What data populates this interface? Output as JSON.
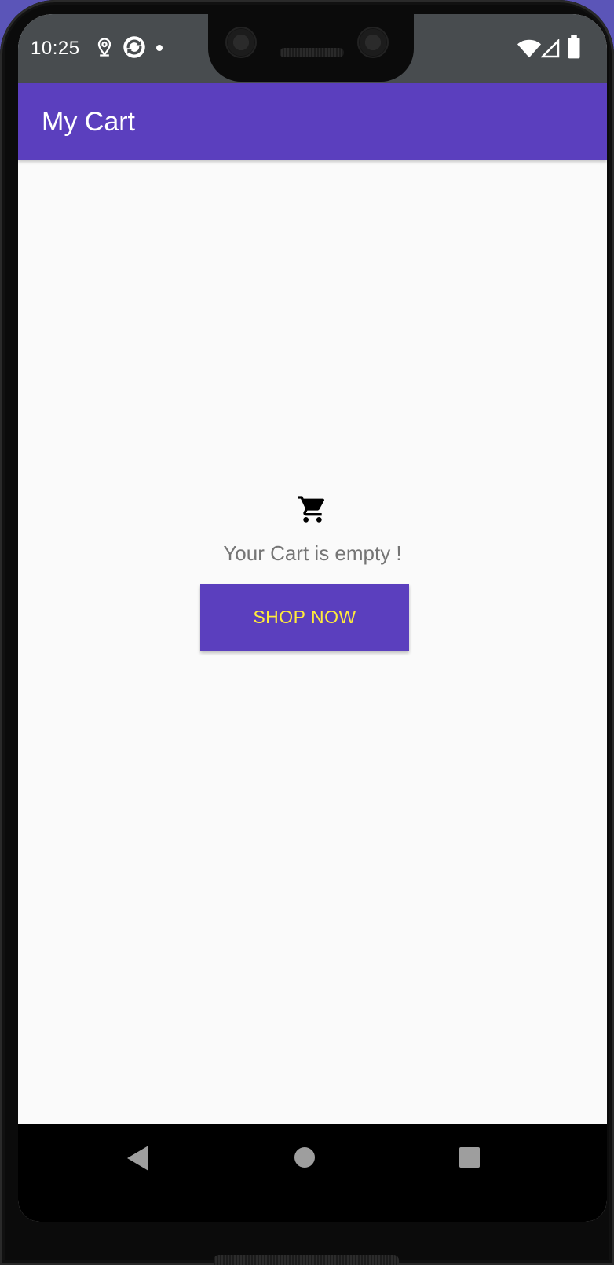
{
  "status_bar": {
    "time": "10:25",
    "left_icons": [
      "location-icon",
      "sync-icon",
      "dot-icon"
    ],
    "right_icons": [
      "wifi-icon",
      "signal-icon",
      "battery-icon"
    ]
  },
  "app_bar": {
    "title": "My Cart",
    "color": "#5b3fbe"
  },
  "empty_state": {
    "icon": "shopping-cart-icon",
    "message": "Your Cart is empty !",
    "button_label": "SHOP NOW",
    "button_color": "#5b3fbe",
    "button_text_color": "#ffeb3b"
  },
  "nav_bar": {
    "buttons": [
      "back-icon",
      "home-icon",
      "recents-icon"
    ]
  }
}
